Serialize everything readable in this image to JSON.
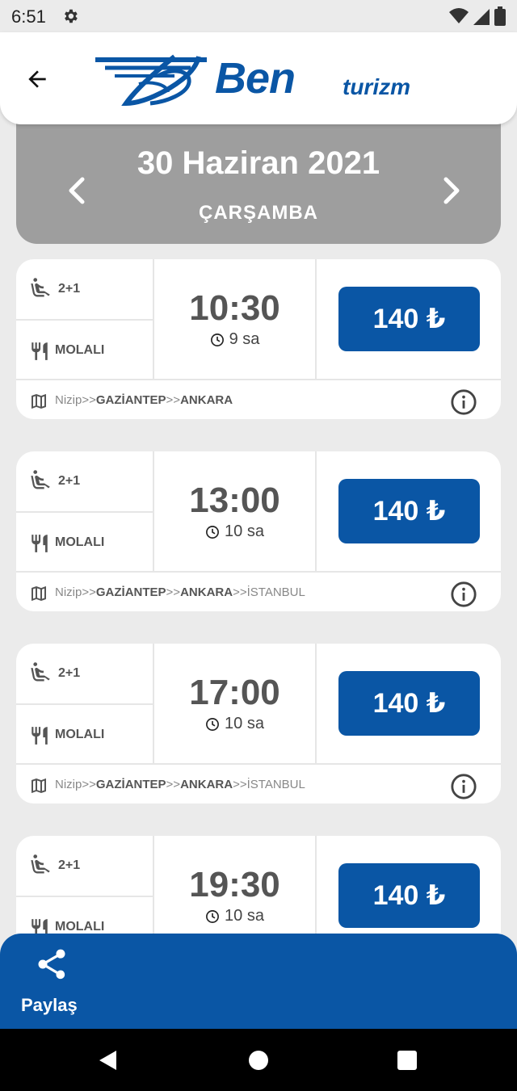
{
  "status_bar": {
    "time": "6:51",
    "icons": [
      "gear-icon",
      "wifi-icon",
      "signal-icon",
      "battery-icon"
    ]
  },
  "header": {
    "back_icon": "arrow-left-icon",
    "logo_brand": "Ben",
    "logo_suffix": "turizm",
    "brand_color": "#0a56a5"
  },
  "date_bar": {
    "date": "30 Haziran 2021",
    "day": "ÇARŞAMBA",
    "prev_icon": "chevron-left-icon",
    "next_icon": "chevron-right-icon"
  },
  "trips": [
    {
      "seat": "2+1",
      "meal": "MOLALI",
      "time": "10:30",
      "duration": "9 sa",
      "price": "140 ₺",
      "route": [
        {
          "text": "Nizip",
          "bold": false
        },
        {
          "text": ">>",
          "bold": false
        },
        {
          "text": "GAZİANTEP",
          "bold": true
        },
        {
          "text": ">>",
          "bold": false
        },
        {
          "text": "ANKARA",
          "bold": true
        }
      ]
    },
    {
      "seat": "2+1",
      "meal": "MOLALI",
      "time": "13:00",
      "duration": "10 sa",
      "price": "140 ₺",
      "route": [
        {
          "text": "Nizip",
          "bold": false
        },
        {
          "text": ">>",
          "bold": false
        },
        {
          "text": "GAZİANTEP",
          "bold": true
        },
        {
          "text": ">>",
          "bold": false
        },
        {
          "text": "ANKARA",
          "bold": true
        },
        {
          "text": ">>",
          "bold": false
        },
        {
          "text": "İSTANBUL",
          "bold": false
        }
      ]
    },
    {
      "seat": "2+1",
      "meal": "MOLALI",
      "time": "17:00",
      "duration": "10 sa",
      "price": "140 ₺",
      "route": [
        {
          "text": "Nizip",
          "bold": false
        },
        {
          "text": ">>",
          "bold": false
        },
        {
          "text": "GAZİANTEP",
          "bold": true
        },
        {
          "text": ">>",
          "bold": false
        },
        {
          "text": "ANKARA",
          "bold": true
        },
        {
          "text": ">>",
          "bold": false
        },
        {
          "text": "İSTANBUL",
          "bold": false
        }
      ]
    },
    {
      "seat": "2+1",
      "meal": "MOLALI",
      "time": "19:30",
      "duration": "10 sa",
      "price": "140 ₺",
      "route": []
    }
  ],
  "bottom_bar": {
    "share_label": "Paylaş",
    "share_icon": "share-icon"
  }
}
